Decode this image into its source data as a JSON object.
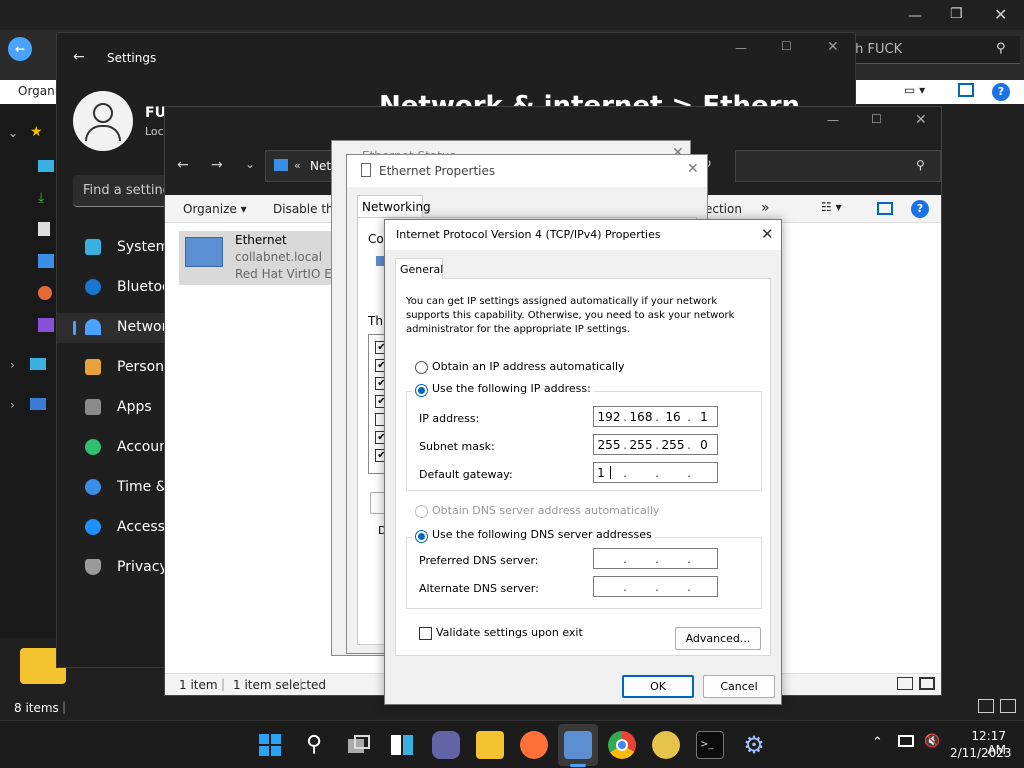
{
  "bg_explorer": {
    "search_placeholder": "ch FUCK",
    "organize": "Organiz",
    "status": "8 items"
  },
  "settings": {
    "title": "Settings",
    "user_name": "FUC",
    "user_sub": "Loc",
    "header": "Network & internet  >  Ethernet",
    "find_placeholder": "Find a setting",
    "nav": [
      "System",
      "Bluetoo",
      "Networ",
      "Persona",
      "Apps",
      "Accoun",
      "Time &",
      "Accessil",
      "Privacy"
    ]
  },
  "netconn": {
    "address_text": "Netw",
    "organize": "Organize",
    "disable": "Disable this",
    "connection": "ection",
    "more": "»",
    "item_name": "Ethernet",
    "item_domain": "collabnet.local",
    "item_adapter": "Red Hat VirtIO E",
    "status_count": "1 item",
    "status_selected": "1 item selected"
  },
  "ethstatus": {
    "title": "Ethernet Status"
  },
  "ethprops": {
    "title": "Ethernet Properties",
    "tab": "Networking",
    "con_label": "Cor",
    "this_label": "This",
    "desc_label": "D"
  },
  "ipv4": {
    "title": "Internet Protocol Version 4 (TCP/IPv4) Properties",
    "tab": "General",
    "intro": "You can get IP settings assigned automatically if your network supports this capability. Otherwise, you need to ask your network administrator for the appropriate IP settings.",
    "auto_ip": "Obtain an IP address automatically",
    "use_ip": "Use the following IP address:",
    "ip_label": "IP address:",
    "subnet_label": "Subnet mask:",
    "gateway_label": "Default gateway:",
    "ip": [
      "192",
      "168",
      "16",
      "1"
    ],
    "subnet": [
      "255",
      "255",
      "255",
      "0"
    ],
    "gateway": [
      "1",
      "",
      "",
      ""
    ],
    "auto_dns": "Obtain DNS server address automatically",
    "use_dns": "Use the following DNS server addresses",
    "pref_dns_label": "Preferred DNS server:",
    "alt_dns_label": "Alternate DNS server:",
    "validate": "Validate settings upon exit",
    "advanced": "Advanced...",
    "ok": "OK",
    "cancel": "Cancel"
  },
  "taskbar": {
    "time": "12:17 AM",
    "date": "2/11/2023"
  }
}
